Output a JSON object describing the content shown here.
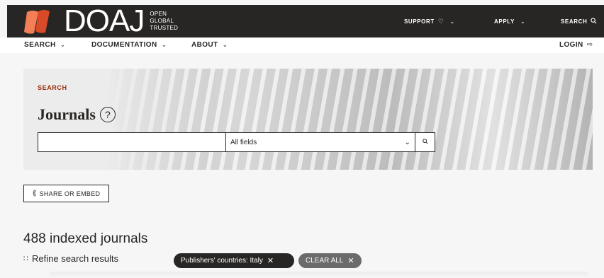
{
  "brand": {
    "name": "DOAJ",
    "tagline": [
      "OPEN",
      "GLOBAL",
      "TRUSTED"
    ],
    "colors": {
      "orange": "#f47e55",
      "red": "#d94a28",
      "dark": "#282624",
      "accent": "#982e0a"
    }
  },
  "topnav": {
    "support": "SUPPORT",
    "support_icon": "heart-icon",
    "apply": "APPLY",
    "search": "SEARCH",
    "search_icon": "search-icon"
  },
  "subnav": {
    "search": "SEARCH",
    "documentation": "DOCUMENTATION",
    "about": "ABOUT",
    "login": "LOGIN"
  },
  "hero": {
    "label": "SEARCH",
    "title": "Journals",
    "help": "?"
  },
  "search": {
    "query": "",
    "field": "All fields"
  },
  "share": {
    "label": "SHARE OR EMBED"
  },
  "results": {
    "count_text": "488 indexed journals",
    "refine_label": "Refine search results"
  },
  "filters": {
    "active": [
      {
        "label": "Publishers' countries: Italy"
      }
    ],
    "clear_all": "CLEAR ALL"
  }
}
